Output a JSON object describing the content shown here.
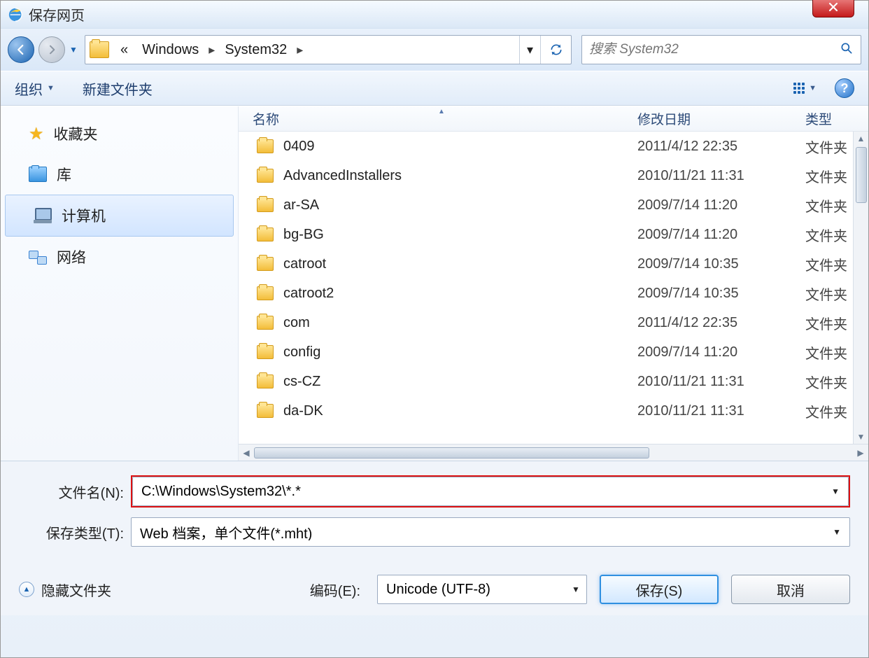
{
  "title": "保存网页",
  "breadcrumb": {
    "chevrons": "«",
    "segments": [
      "Windows",
      "System32"
    ]
  },
  "search": {
    "placeholder": "搜索 System32"
  },
  "toolbar": {
    "organize": "组织",
    "newfolder": "新建文件夹"
  },
  "columns": {
    "name": "名称",
    "date": "修改日期",
    "type": "类型"
  },
  "sidebar": {
    "favorites": "收藏夹",
    "libraries": "库",
    "computer": "计算机",
    "network": "网络"
  },
  "rows": [
    {
      "name": "0409",
      "date": "2011/4/12 22:35",
      "type": "文件夹"
    },
    {
      "name": "AdvancedInstallers",
      "date": "2010/11/21 11:31",
      "type": "文件夹"
    },
    {
      "name": "ar-SA",
      "date": "2009/7/14 11:20",
      "type": "文件夹"
    },
    {
      "name": "bg-BG",
      "date": "2009/7/14 11:20",
      "type": "文件夹"
    },
    {
      "name": "catroot",
      "date": "2009/7/14 10:35",
      "type": "文件夹"
    },
    {
      "name": "catroot2",
      "date": "2009/7/14 10:35",
      "type": "文件夹"
    },
    {
      "name": "com",
      "date": "2011/4/12 22:35",
      "type": "文件夹"
    },
    {
      "name": "config",
      "date": "2009/7/14 11:20",
      "type": "文件夹"
    },
    {
      "name": "cs-CZ",
      "date": "2010/11/21 11:31",
      "type": "文件夹"
    },
    {
      "name": "da-DK",
      "date": "2010/11/21 11:31",
      "type": "文件夹"
    }
  ],
  "form": {
    "filename_label": "文件名(N):",
    "filename_value": "C:\\Windows\\System32\\*.*",
    "type_label": "保存类型(T):",
    "type_value": "Web 档案，单个文件(*.mht)",
    "encoding_label": "编码(E):",
    "encoding_value": "Unicode (UTF-8)",
    "hide_folders": "隐藏文件夹",
    "save": "保存(S)",
    "cancel": "取消"
  }
}
